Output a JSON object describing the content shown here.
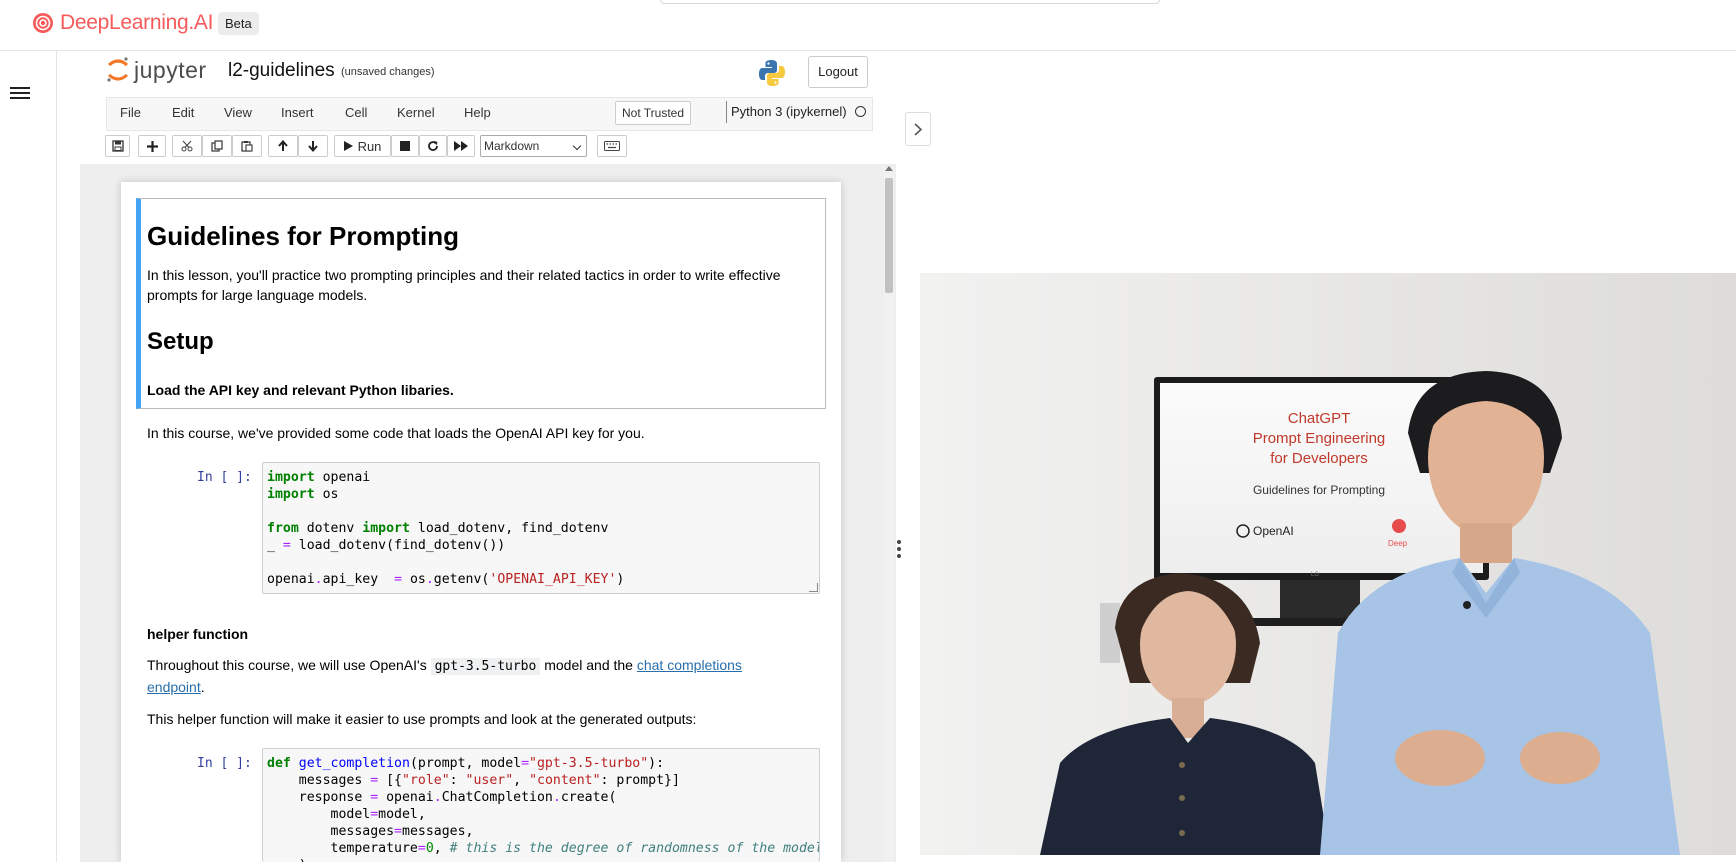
{
  "brand": {
    "name": "DeepLearning.AI",
    "badge": "Beta"
  },
  "notebook": {
    "app_name": "jupyter",
    "title": "l2-guidelines",
    "status": "(unsaved changes)",
    "logout_label": "Logout"
  },
  "menu": {
    "items": [
      "File",
      "Edit",
      "View",
      "Insert",
      "Cell",
      "Kernel",
      "Help"
    ],
    "trust_label": "Not Trusted",
    "kernel_label": "Python 3 (ipykernel)"
  },
  "toolbar": {
    "run_label": "Run",
    "cell_type": "Markdown"
  },
  "cells": {
    "md1_h1": "Guidelines for Prompting",
    "md1_p": "In this lesson, you'll practice two prompting principles and their related tactics in order to write effective prompts for large language models.",
    "md1_h2": "Setup",
    "md1_bold": "Load the API key and relevant Python libaries.",
    "md2_p": "In this course, we've provided some code that loads the OpenAI API key for you.",
    "prompt1": "In [ ]:",
    "md3_bold": "helper function",
    "md4_p_pre": "Throughout this course, we will use OpenAI's",
    "md4_code": "gpt-3.5-turbo",
    "md4_p_mid": "model and the",
    "md4_link_line1": "chat completions",
    "md4_link_line2": "endpoint",
    "md4_p_end": ".",
    "md5_p": "This helper function will make it easier to use prompts and look at the generated outputs:",
    "prompt2": "In [ ]:"
  },
  "video": {
    "slide_line1": "ChatGPT",
    "slide_line2": "Prompt Engineering",
    "slide_line3": "for Developers",
    "slide_subtitle": "Guidelines for Prompting",
    "slide_logo1": "OpenAI",
    "slide_logo2": "Deep",
    "monitor_brand": "LG"
  },
  "colors": {
    "brand": "#f65a5b",
    "jupyter_orange": "#f37726",
    "selected_cell_border": "#42a5f5",
    "prompt_blue": "#303f9f"
  }
}
